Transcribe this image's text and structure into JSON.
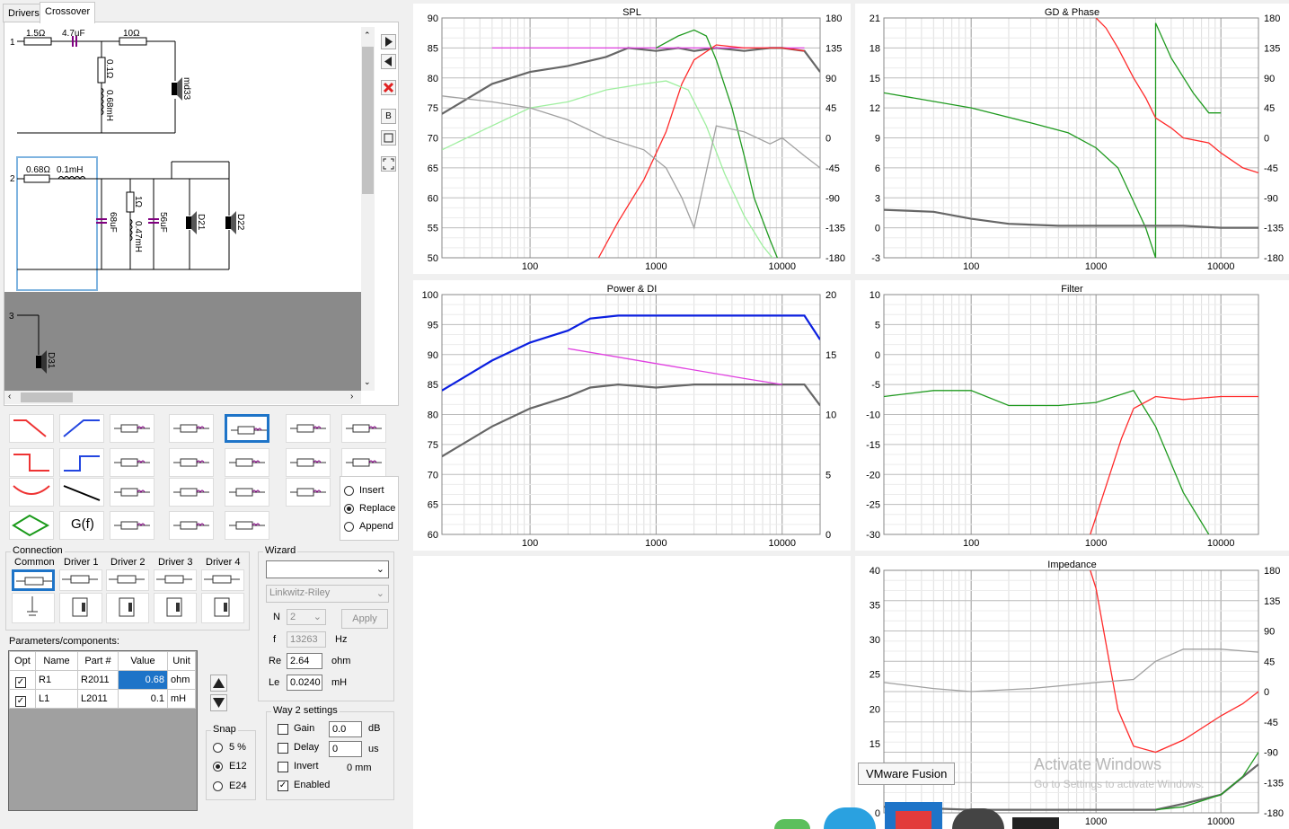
{
  "tabs": [
    {
      "label": "Drivers"
    },
    {
      "label": "Crossover"
    }
  ],
  "schematic": {
    "way1": {
      "number": "1",
      "r1": "1.5Ω",
      "c1": "4.7uF",
      "r2": "10Ω",
      "shunt_r": "0.1Ω",
      "shunt_l": "0.68mH",
      "driver": "md33"
    },
    "way2": {
      "number": "2",
      "r": "0.68Ω",
      "l": "0.1mH",
      "c1": "68uF",
      "r2": "1Ω",
      "l2": "0.47mH",
      "c2": "56uF",
      "driver1": "D21",
      "driver2": "D22"
    },
    "way3": {
      "number": "3",
      "driver": "D31"
    }
  },
  "side_buttons": {
    "b_label": "B"
  },
  "library": {
    "gf_label": "G(f)"
  },
  "mode": {
    "options": [
      "Insert",
      "Replace",
      "Append"
    ],
    "selected": "Replace"
  },
  "connection": {
    "title": "Connection",
    "tabs": [
      "Common",
      "Driver 1",
      "Driver 2",
      "Driver 3",
      "Driver 4"
    ]
  },
  "wizard": {
    "title": "Wizard",
    "type_value": "",
    "filter_value": "Linkwitz-Riley",
    "n_label": "N",
    "n_value": "2",
    "apply_label": "Apply",
    "f_label": "f",
    "f_value": "13263",
    "f_unit": "Hz",
    "re_label": "Re",
    "re_value": "2.64",
    "re_unit": "ohm",
    "le_label": "Le",
    "le_value": "0.0240",
    "le_unit": "mH"
  },
  "params": {
    "title": "Parameters/components:",
    "columns": [
      "Opt",
      "Name",
      "Part #",
      "Value",
      "Unit"
    ],
    "rows": [
      {
        "checked": true,
        "name": "R1",
        "part": "R2011",
        "value": "0.68",
        "unit": "ohm"
      },
      {
        "checked": true,
        "name": "L1",
        "part": "L2011",
        "value": "0.1",
        "unit": "mH"
      }
    ]
  },
  "snap": {
    "title": "Snap",
    "options": [
      "5 %",
      "E12",
      "E24"
    ],
    "selected": "E12"
  },
  "way_settings": {
    "title": "Way 2 settings",
    "gain_label": "Gain",
    "gain_value": "0.0",
    "gain_unit": "dB",
    "delay_label": "Delay",
    "delay_value": "0",
    "delay_unit": "us",
    "invert_label": "Invert",
    "invert_value": "0 mm",
    "enabled_label": "Enabled",
    "enabled_checked": true
  },
  "tooltip": "VMware Fusion",
  "watermark": {
    "line1": "Activate Windows",
    "line2": "Go to Settings to activate Windows."
  },
  "colors": {
    "accent": "#1e74c8",
    "spl_gray": "#666666",
    "red": "#ff2a2a",
    "green": "#1f9a1f",
    "blue": "#0b1fe0",
    "magenta": "#e040e0",
    "lightgreen": "#9fef9f"
  },
  "chart_data": [
    {
      "type": "line",
      "title": "SPL",
      "x_ticks": [
        "100",
        "1000",
        "10000"
      ],
      "y_ticks": [
        "90",
        "85",
        "80",
        "75",
        "70",
        "65",
        "60",
        "55",
        "50"
      ],
      "y2_ticks": [
        "180",
        "135",
        "90",
        "45",
        "0",
        "-45",
        "-90",
        "-135",
        "-180"
      ],
      "series": [
        {
          "color": "#666666",
          "x": [
            20,
            50,
            100,
            200,
            400,
            600,
            1000,
            1500,
            2000,
            3000,
            5000,
            8000,
            10000,
            15000,
            20000
          ],
          "y": [
            74,
            79,
            81,
            82,
            83.5,
            85,
            84.5,
            85,
            84.5,
            85,
            84.5,
            85,
            85,
            84.5,
            81
          ]
        },
        {
          "color": "#e040e0",
          "x": [
            50,
            100,
            200,
            500,
            1000,
            2000,
            5000,
            10000,
            15000
          ],
          "y": [
            85,
            85,
            85,
            85,
            85,
            85,
            85,
            85,
            85
          ]
        },
        {
          "color": "#ff2a2a",
          "x": [
            350,
            500,
            800,
            1200,
            1600,
            2000,
            3000,
            5000,
            10000,
            15000
          ],
          "y": [
            50,
            56,
            63,
            71,
            79,
            83,
            85.5,
            85,
            85,
            84.5
          ]
        },
        {
          "color": "#1f9a1f",
          "x": [
            1000,
            1500,
            2000,
            2500,
            3000,
            4000,
            5000,
            6000,
            8000,
            10000
          ],
          "y": [
            85,
            87,
            88,
            87,
            83,
            75,
            67,
            60,
            53,
            48
          ]
        },
        {
          "color": "#9fef9f",
          "x": [
            20,
            50,
            100,
            200,
            400,
            800,
            1200,
            1800,
            2500,
            3500,
            5000,
            7000,
            10000
          ],
          "y": [
            68,
            72,
            75,
            76,
            78,
            79,
            79.5,
            78,
            72,
            64,
            57,
            52,
            48
          ]
        },
        {
          "color": "#a0a0a0",
          "x": [
            20,
            50,
            100,
            200,
            400,
            800,
            1200,
            1600,
            2000,
            3000,
            5000,
            8000,
            10000,
            15000,
            20000
          ],
          "y": [
            77,
            76,
            75,
            73,
            70,
            68,
            65,
            60,
            55,
            72,
            71,
            69,
            70,
            67,
            65
          ]
        }
      ]
    },
    {
      "type": "line",
      "title": "GD & Phase",
      "x_ticks": [
        "100",
        "1000",
        "10000"
      ],
      "y_ticks": [
        "21",
        "18",
        "15",
        "12",
        "9",
        "6",
        "3",
        "0",
        "-3"
      ],
      "y2_ticks": [
        "180",
        "135",
        "90",
        "45",
        "0",
        "-45",
        "-90",
        "-135",
        "-180"
      ],
      "series": [
        {
          "color": "#1f9a1f",
          "x": [
            20,
            100,
            300,
            600,
            1000,
            1500,
            2500,
            3000,
            3000,
            4000,
            6000,
            8000,
            10000
          ],
          "y": [
            13.5,
            12,
            10.5,
            9.5,
            8,
            6,
            0,
            -3,
            20.5,
            17,
            13.5,
            11.5,
            11.5
          ]
        },
        {
          "color": "#ff2a2a",
          "x": [
            1000,
            1200,
            1500,
            2000,
            2500,
            3000,
            4000,
            5000,
            8000,
            10000,
            15000,
            20000
          ],
          "y": [
            21,
            20,
            18,
            15,
            13,
            11,
            10,
            9,
            8.5,
            7.5,
            6,
            5.5
          ]
        },
        {
          "color": "#666666",
          "x": [
            20,
            50,
            100,
            200,
            500,
            1000,
            2000,
            5000,
            10000,
            20000
          ],
          "y": [
            1.8,
            1.6,
            0.9,
            0.4,
            0.2,
            0.2,
            0.2,
            0.2,
            0.0,
            0.0
          ]
        }
      ]
    },
    {
      "type": "line",
      "title": "Power & DI",
      "x_ticks": [
        "100",
        "1000",
        "10000"
      ],
      "y_ticks": [
        "100",
        "95",
        "90",
        "85",
        "80",
        "75",
        "70",
        "65",
        "60"
      ],
      "y2_ticks": [
        "20",
        "15",
        "10",
        "5",
        "0"
      ],
      "series": [
        {
          "color": "#0b1fe0",
          "x": [
            20,
            50,
            100,
            200,
            300,
            500,
            1000,
            2000,
            5000,
            10000,
            15000,
            20000
          ],
          "y": [
            84,
            89,
            92,
            94,
            96,
            96.5,
            96.5,
            96.5,
            96.5,
            96.5,
            96.5,
            92.5
          ]
        },
        {
          "color": "#666666",
          "x": [
            20,
            50,
            100,
            200,
            300,
            500,
            1000,
            2000,
            5000,
            10000,
            15000,
            20000
          ],
          "y": [
            73,
            78,
            81,
            83,
            84.5,
            85,
            84.5,
            85,
            85,
            85,
            85,
            81.5
          ]
        },
        {
          "color": "#e040e0",
          "x": [
            200,
            1000,
            5000,
            10000
          ],
          "y": [
            91,
            88.5,
            86,
            85
          ]
        }
      ]
    },
    {
      "type": "line",
      "title": "Filter",
      "x_ticks": [
        "100",
        "1000",
        "10000"
      ],
      "y_ticks": [
        "10",
        "5",
        "0",
        "-5",
        "-10",
        "-15",
        "-20",
        "-25",
        "-30"
      ],
      "series": [
        {
          "color": "#1f9a1f",
          "x": [
            20,
            50,
            100,
            200,
            500,
            1000,
            2000,
            3000,
            5000,
            8000
          ],
          "y": [
            -7,
            -6,
            -6,
            -8.5,
            -8.5,
            -8,
            -6,
            -12,
            -23,
            -30
          ]
        },
        {
          "color": "#ff2a2a",
          "x": [
            900,
            1200,
            1600,
            2000,
            3000,
            5000,
            10000,
            20000
          ],
          "y": [
            -30,
            -22,
            -14,
            -9,
            -7,
            -7.5,
            -7,
            -7
          ]
        }
      ]
    },
    {
      "type": "line",
      "title": "Impedance",
      "x_ticks": [
        "1000",
        "10000"
      ],
      "y_ticks": [
        "40",
        "35",
        "30",
        "25",
        "20",
        "15",
        "10",
        "0"
      ],
      "y2_ticks": [
        "180",
        "135",
        "90",
        "45",
        "0",
        "-45",
        "-90",
        "-135",
        "-180"
      ],
      "series": [
        {
          "color": "#ff2a2a",
          "x": [
            900,
            1000,
            1500,
            2000,
            3000,
            5000,
            10000,
            15000,
            20000
          ],
          "y": [
            40,
            37,
            17,
            11,
            10,
            12,
            16,
            18,
            20
          ]
        },
        {
          "color": "#a0a0a0",
          "x": [
            20,
            50,
            100,
            300,
            1000,
            2000,
            3000,
            5000,
            10000,
            20000
          ],
          "y": [
            21.5,
            20.5,
            20,
            20.5,
            21.5,
            22,
            25,
            27,
            27,
            26.5
          ]
        },
        {
          "color": "#666666",
          "x": [
            20,
            100,
            1000,
            3000,
            5000,
            10000,
            20000
          ],
          "y": [
            1,
            0.5,
            0.5,
            0.5,
            1.5,
            3,
            8
          ]
        },
        {
          "color": "#1f9a1f",
          "x": [
            3000,
            5000,
            10000,
            15000,
            20000
          ],
          "y": [
            0.5,
            1,
            3,
            6,
            10
          ]
        }
      ]
    }
  ]
}
